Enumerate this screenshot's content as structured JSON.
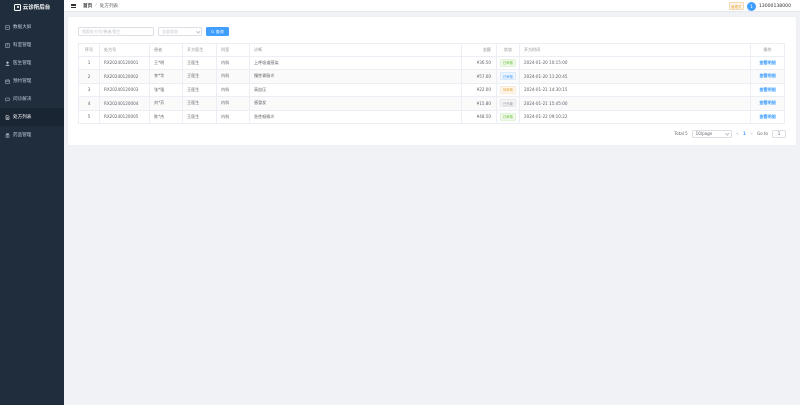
{
  "sidebar": {
    "brand": "云诊所后台",
    "items": [
      {
        "label": "数据大屏",
        "icon": "dashboard-icon",
        "active": false
      },
      {
        "label": "科室管理",
        "icon": "department-icon",
        "active": false
      },
      {
        "label": "医生管理",
        "icon": "doctor-icon",
        "active": false
      },
      {
        "label": "预约管理",
        "icon": "calendar-icon",
        "active": false
      },
      {
        "label": "问诊解决",
        "icon": "chat-icon",
        "active": false
      },
      {
        "label": "处方列表",
        "icon": "prescription-icon",
        "active": true
      },
      {
        "label": "药品管理",
        "icon": "medicine-icon",
        "active": false
      }
    ]
  },
  "header": {
    "breadcrumb_home": "首页",
    "breadcrumb_sep": "/",
    "breadcrumb_current": "处方列表",
    "role_badge": "管理员",
    "avatar_letter": "1",
    "username": "13000138000"
  },
  "filters": {
    "search_placeholder": "搜索处方号/患者/医生",
    "status_placeholder": "全部状态",
    "query_label": "查询"
  },
  "table": {
    "columns": [
      "序号",
      "处方号",
      "患者",
      "开方医生",
      "科室",
      "诊断",
      "金额",
      "状态",
      "开方时间",
      "操作"
    ],
    "rows": [
      {
        "idx": "1",
        "no": "RX20240120001",
        "patient": "王*明",
        "doctor": "王医生",
        "dept": "内科",
        "diagnosis": "上呼吸道感染",
        "amount": "¥36.50",
        "status": "已审核",
        "status_type": "success",
        "time": "2024-01-20 10:15:00",
        "action": "查看明细"
      },
      {
        "idx": "2",
        "no": "RX20240120002",
        "patient": "李*华",
        "doctor": "王医生",
        "dept": "内科",
        "diagnosis": "慢性胃肠炎",
        "amount": "¥57.00",
        "status": "已审核",
        "status_type": "primary",
        "time": "2024-01-20 11:20:45",
        "action": "查看明细"
      },
      {
        "idx": "3",
        "no": "RX20240120003",
        "patient": "张*强",
        "doctor": "王医生",
        "dept": "内科",
        "diagnosis": "高血压",
        "amount": "¥22.00",
        "status": "待审核",
        "status_type": "warning",
        "time": "2024-01-21 14:30:15",
        "action": "查看明细"
      },
      {
        "idx": "4",
        "no": "RX20240120004",
        "patient": "刘*芳",
        "doctor": "王医生",
        "dept": "内科",
        "diagnosis": "感冒发",
        "amount": "¥15.80",
        "status": "已作废",
        "status_type": "info",
        "time": "2024-01-21 15:45:00",
        "action": "查看明细"
      },
      {
        "idx": "5",
        "no": "RX20240120005",
        "patient": "陈*杰",
        "doctor": "王医生",
        "dept": "内科",
        "diagnosis": "急性咽喉炎",
        "amount": "¥48.50",
        "status": "已审核",
        "status_type": "success",
        "time": "2024-01-22 09:10:22",
        "action": "查看明细"
      }
    ]
  },
  "pagination": {
    "total_label": "Total 5",
    "page_size": "10/page",
    "prev": "<",
    "current_page": "1",
    "next": ">",
    "goto_label": "Go to",
    "goto_value": "1"
  },
  "colors": {
    "sidebar_bg": "#1f2d3d",
    "primary": "#409eff",
    "success": "#67c23a",
    "warning": "#e6a23c",
    "info": "#909399"
  }
}
